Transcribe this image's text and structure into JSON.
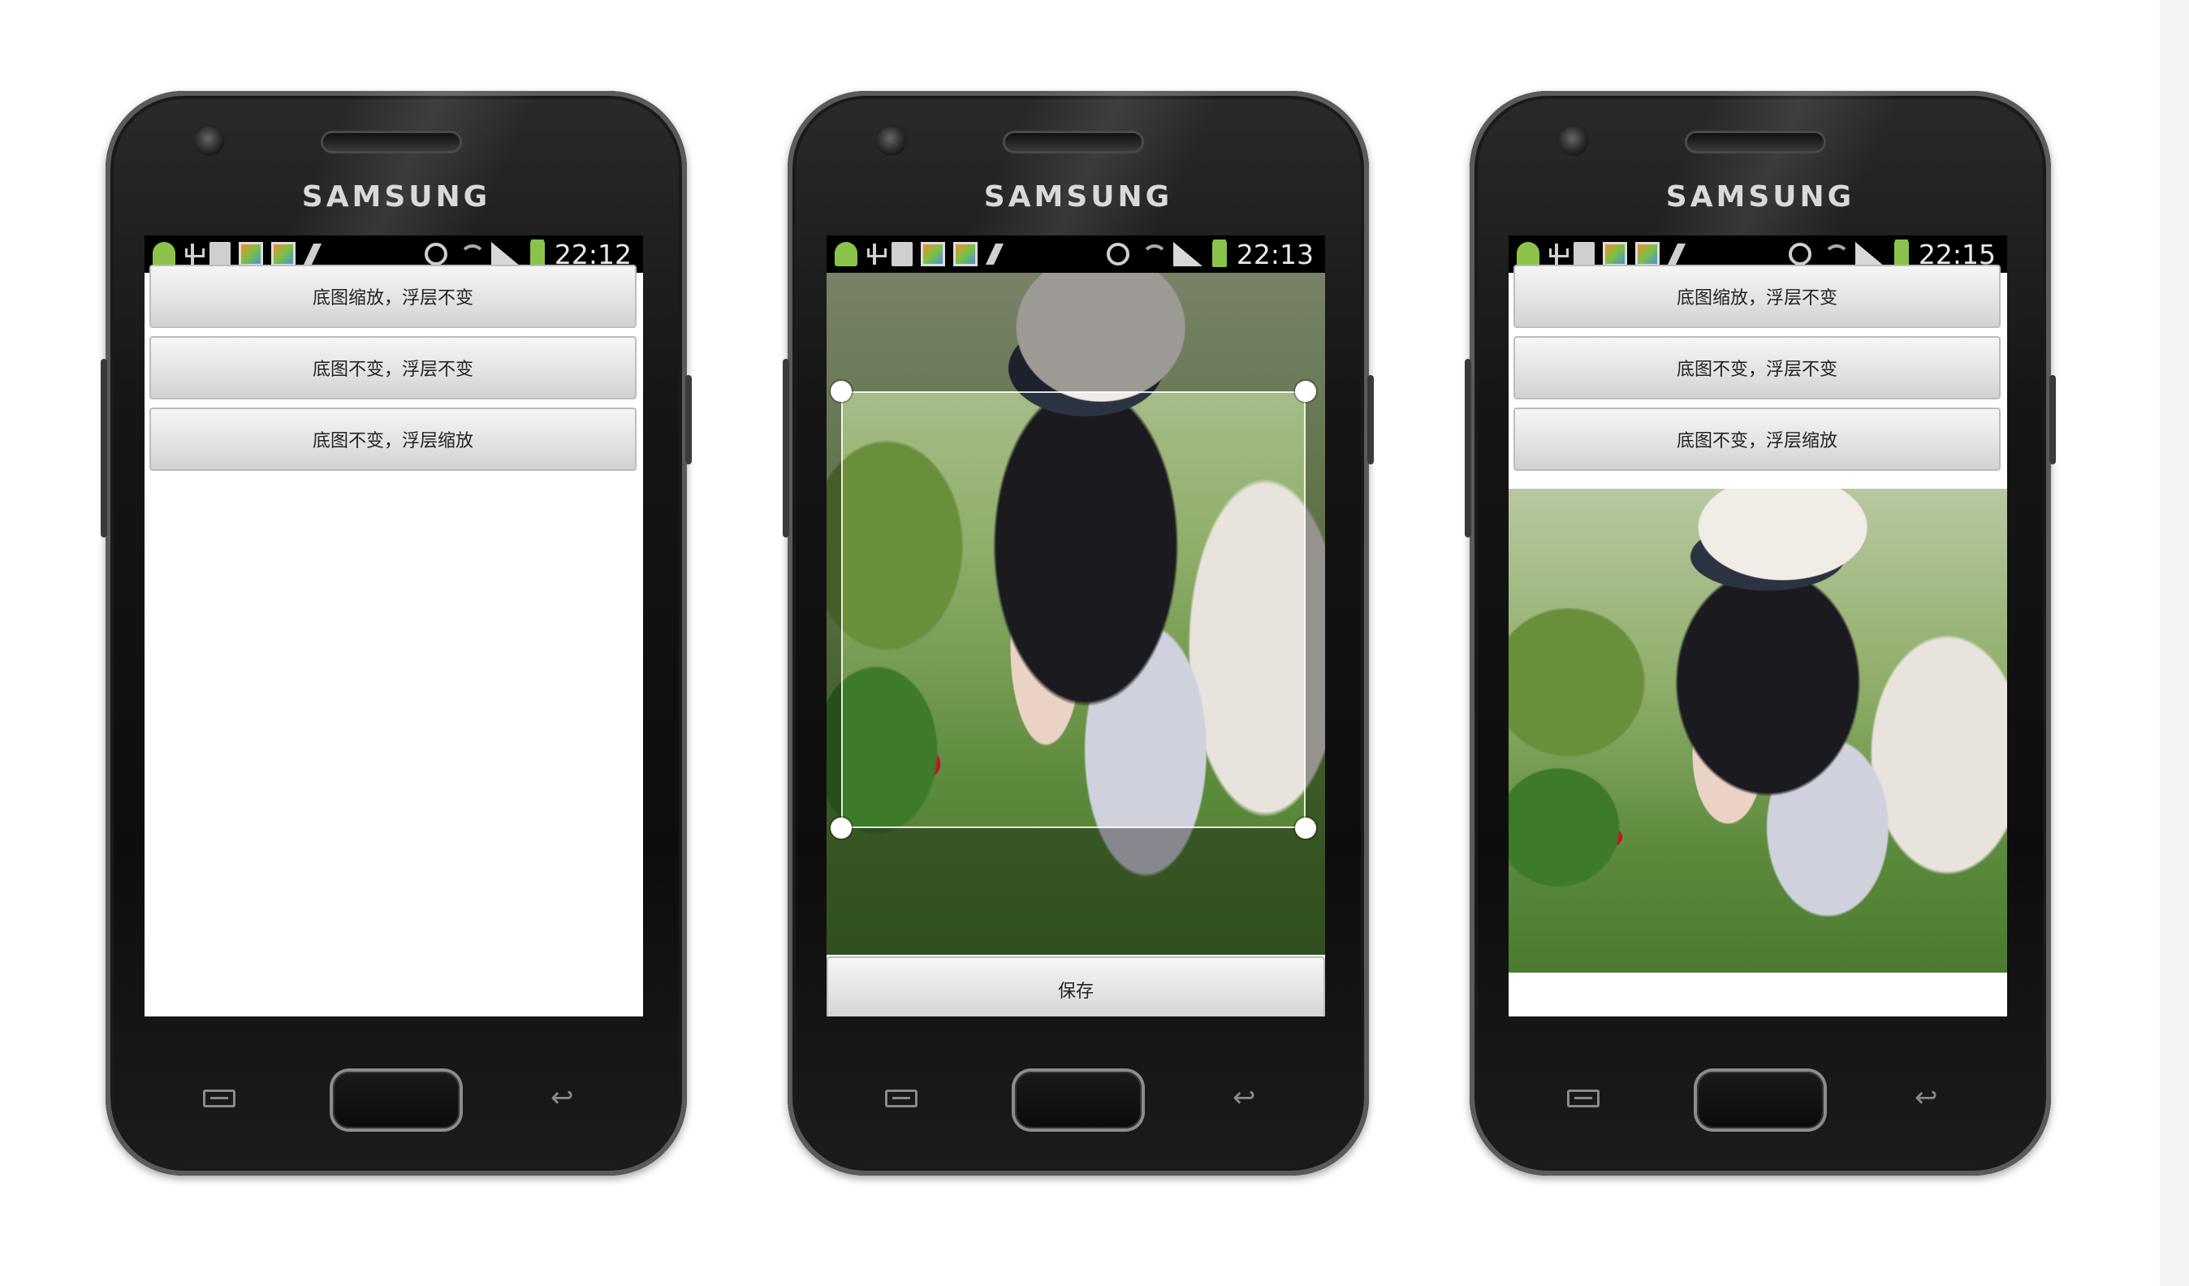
{
  "phones": [
    {
      "brand": "SAMSUNG",
      "status": {
        "time": "22:12"
      },
      "buttons": [
        "底图缩放，浮层不变",
        "底图不变，浮层不变",
        "底图不变，浮层缩放"
      ]
    },
    {
      "brand": "SAMSUNG",
      "status": {
        "time": "22:13"
      },
      "crop": {
        "save_label": "保存"
      }
    },
    {
      "brand": "SAMSUNG",
      "status": {
        "time": "22:15"
      },
      "buttons": [
        "底图缩放，浮层不变",
        "底图不变，浮层不变",
        "底图不变，浮层缩放"
      ]
    }
  ],
  "icons": {
    "status_left": [
      "android-notification-icon",
      "usb-icon",
      "sd-card-icon",
      "app-icon",
      "app-icon",
      "flash-icon"
    ],
    "status_right": [
      "alarm-icon",
      "wifi-icon",
      "signal-icon",
      "battery-icon"
    ],
    "keys": [
      "menu-key-icon",
      "home-button",
      "back-key-icon"
    ]
  },
  "colors": {
    "status_bar": "#000000",
    "button_gradient_top": "#f6f6f6",
    "button_gradient_bottom": "#d2d2d2",
    "battery": "#8bc34a"
  }
}
